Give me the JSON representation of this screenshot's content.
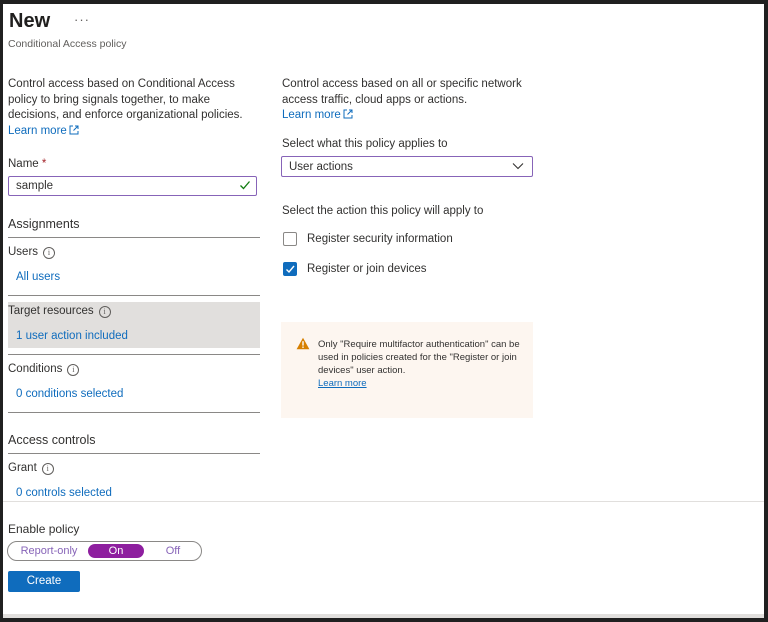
{
  "header": {
    "title": "New",
    "more_label": "···",
    "subtitle": "Conditional Access policy"
  },
  "left": {
    "intro": "Control access based on Conditional Access policy to bring signals together, to make decisions, and enforce organizational policies.",
    "learn_more": "Learn more",
    "name_label": "Name",
    "name_required": "*",
    "name_value": "sample",
    "assignments_heading": "Assignments",
    "users_label": "Users",
    "users_value": "All users",
    "target_label": "Target resources",
    "target_value": "1 user action included",
    "conditions_label": "Conditions",
    "conditions_value": "0 conditions selected",
    "access_controls_heading": "Access controls",
    "grant_label": "Grant",
    "grant_value": "0 controls selected"
  },
  "right": {
    "intro": "Control access based on all or specific network access traffic, cloud apps or actions.",
    "learn_more": "Learn more",
    "applies_label": "Select what this policy applies to",
    "applies_value": "User actions",
    "action_label": "Select the action this policy will apply to",
    "actions": [
      {
        "label": "Register security information",
        "checked": false
      },
      {
        "label": "Register or join devices",
        "checked": true
      }
    ],
    "warning_text": "Only \"Require multifactor authentication\" can be used in policies created for the \"Register or join devices\" user action.",
    "warning_link": "Learn more"
  },
  "footer": {
    "enable_label": "Enable policy",
    "options": [
      "Report-only",
      "On",
      "Off"
    ],
    "selected": "On",
    "create_label": "Create"
  },
  "colors": {
    "accent": "#0f6cbd",
    "toggle_on": "#8e1f9f",
    "warning_bg": "#fdf6f0",
    "warning_icon": "#d67f00"
  }
}
